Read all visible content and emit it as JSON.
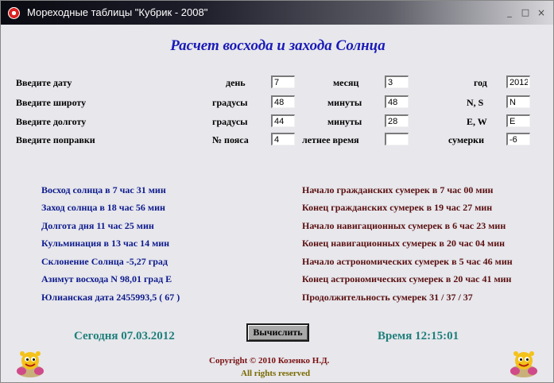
{
  "window": {
    "title": "Мореходные таблицы \"Кубрик - 2008\"",
    "controls": {
      "minimize": "_",
      "maximize": "□",
      "close": "×"
    }
  },
  "heading": "Расчет восхода и захода Солнца",
  "form": {
    "date": {
      "label": "Введите дату",
      "sub1": "день",
      "val1": "7",
      "sub2": "месяц",
      "val2": "3",
      "sub3": "год",
      "val3": "2012"
    },
    "lat": {
      "label": "Введите широту",
      "sub1": "градусы",
      "val1": "48",
      "sub2": "минуты",
      "val2": "48",
      "sub3": "N, S",
      "val3": "N"
    },
    "lon": {
      "label": "Введите долготу",
      "sub1": "градусы",
      "val1": "44",
      "sub2": "минуты",
      "val2": "28",
      "sub3": "E, W",
      "val3": "E"
    },
    "corr": {
      "label": "Введите поправки",
      "sub1": "№ пояса",
      "val1": "4",
      "sub2": "летнее время",
      "val2": "",
      "sub3": "сумерки",
      "val3": "-6"
    }
  },
  "results": {
    "left": [
      "Восход солнца в 7 час 31 мин",
      "Заход солнца в 18 час 56 мин",
      "Долгота дня 11 час 25 мин",
      "Кульминация в 13 час 14 мин",
      "Склонение Солнца -5,27 град",
      "Азимут восхода N 98,01 град E",
      "Юлианская дата 2455993,5 ( 67 )"
    ],
    "right": [
      "Начало гражданских сумерек в 7 час 00 мин",
      "Конец гражданских сумерек в 19 час 27 мин",
      "Начало навигационных сумерек в 6 час 23 мин",
      "Конец навигационных сумерек в 20 час 04 мин",
      "Начало астрономических сумерек в 5 час 46 мин",
      "Конец астрономических сумерек в 20 час 41 мин",
      "Продолжительность сумерек  31 / 37 / 37"
    ]
  },
  "footer": {
    "today": "Сегодня 07.03.2012",
    "time": "Время 12:15:01",
    "calc_button": "Вычислить",
    "copyright": "Copyright © 2010 Козенко Н.Д.",
    "rights": "All rights reserved"
  },
  "icons": {
    "app": "lifebuoy-icon",
    "mascot": "cartoon-mascot-icon"
  },
  "colors": {
    "heading": "#1a1ab8",
    "results_left": "#0d1a8c",
    "results_right": "#5a0f0f",
    "status": "#1f7f7a"
  }
}
